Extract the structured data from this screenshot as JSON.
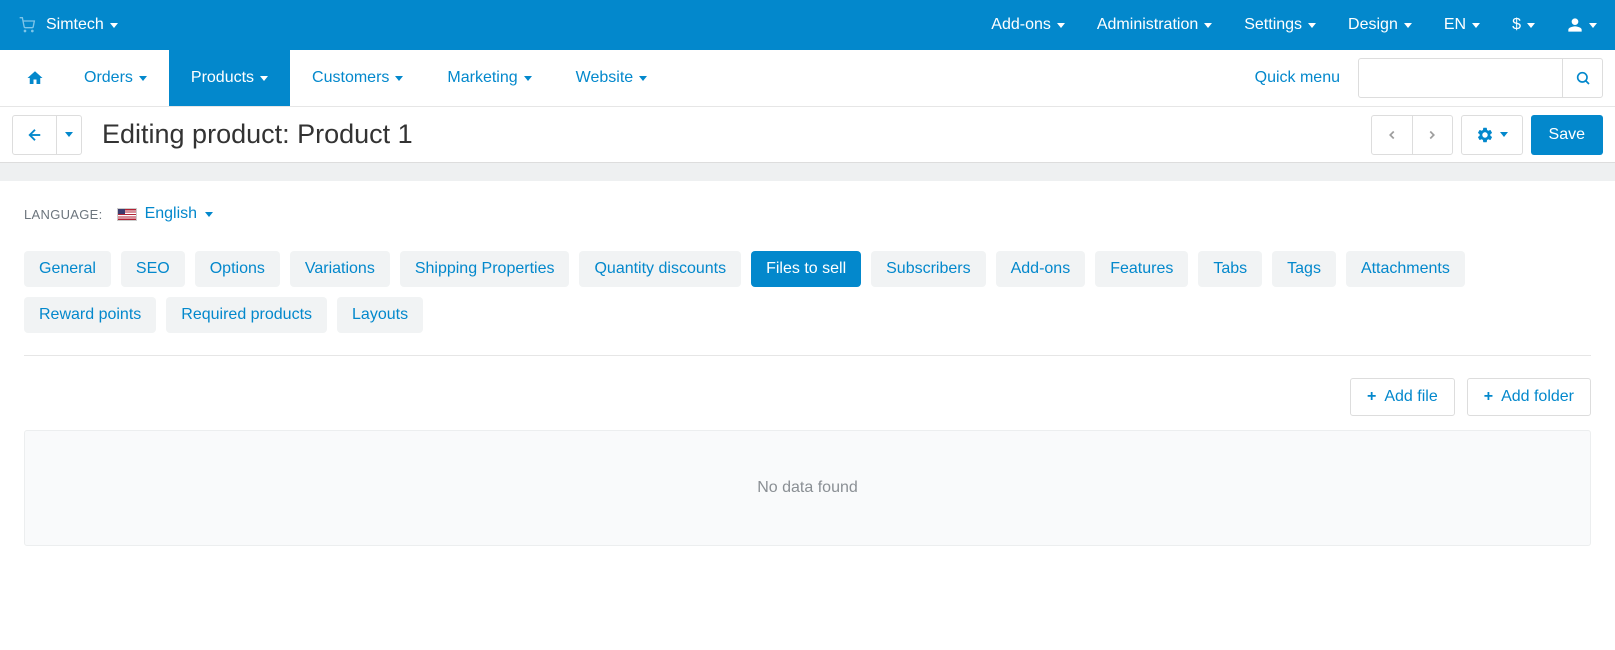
{
  "topbar": {
    "brand": "Simtech",
    "menu": [
      "Add-ons",
      "Administration",
      "Settings",
      "Design",
      "EN",
      "$"
    ]
  },
  "mainnav": {
    "items": [
      "Orders",
      "Products",
      "Customers",
      "Marketing",
      "Website"
    ],
    "active_index": 1,
    "quick_menu": "Quick menu",
    "search_placeholder": ""
  },
  "titlebar": {
    "title": "Editing product: Product 1",
    "save_label": "Save"
  },
  "language": {
    "label": "LANGUAGE:",
    "value": "English"
  },
  "tabs": {
    "items": [
      "General",
      "SEO",
      "Options",
      "Variations",
      "Shipping Properties",
      "Quantity discounts",
      "Files to sell",
      "Subscribers",
      "Add-ons",
      "Features",
      "Tabs",
      "Tags",
      "Attachments",
      "Reward points",
      "Required products",
      "Layouts"
    ],
    "active_index": 6
  },
  "actions": {
    "add_file": "Add file",
    "add_folder": "Add folder"
  },
  "nodata": "No data found"
}
